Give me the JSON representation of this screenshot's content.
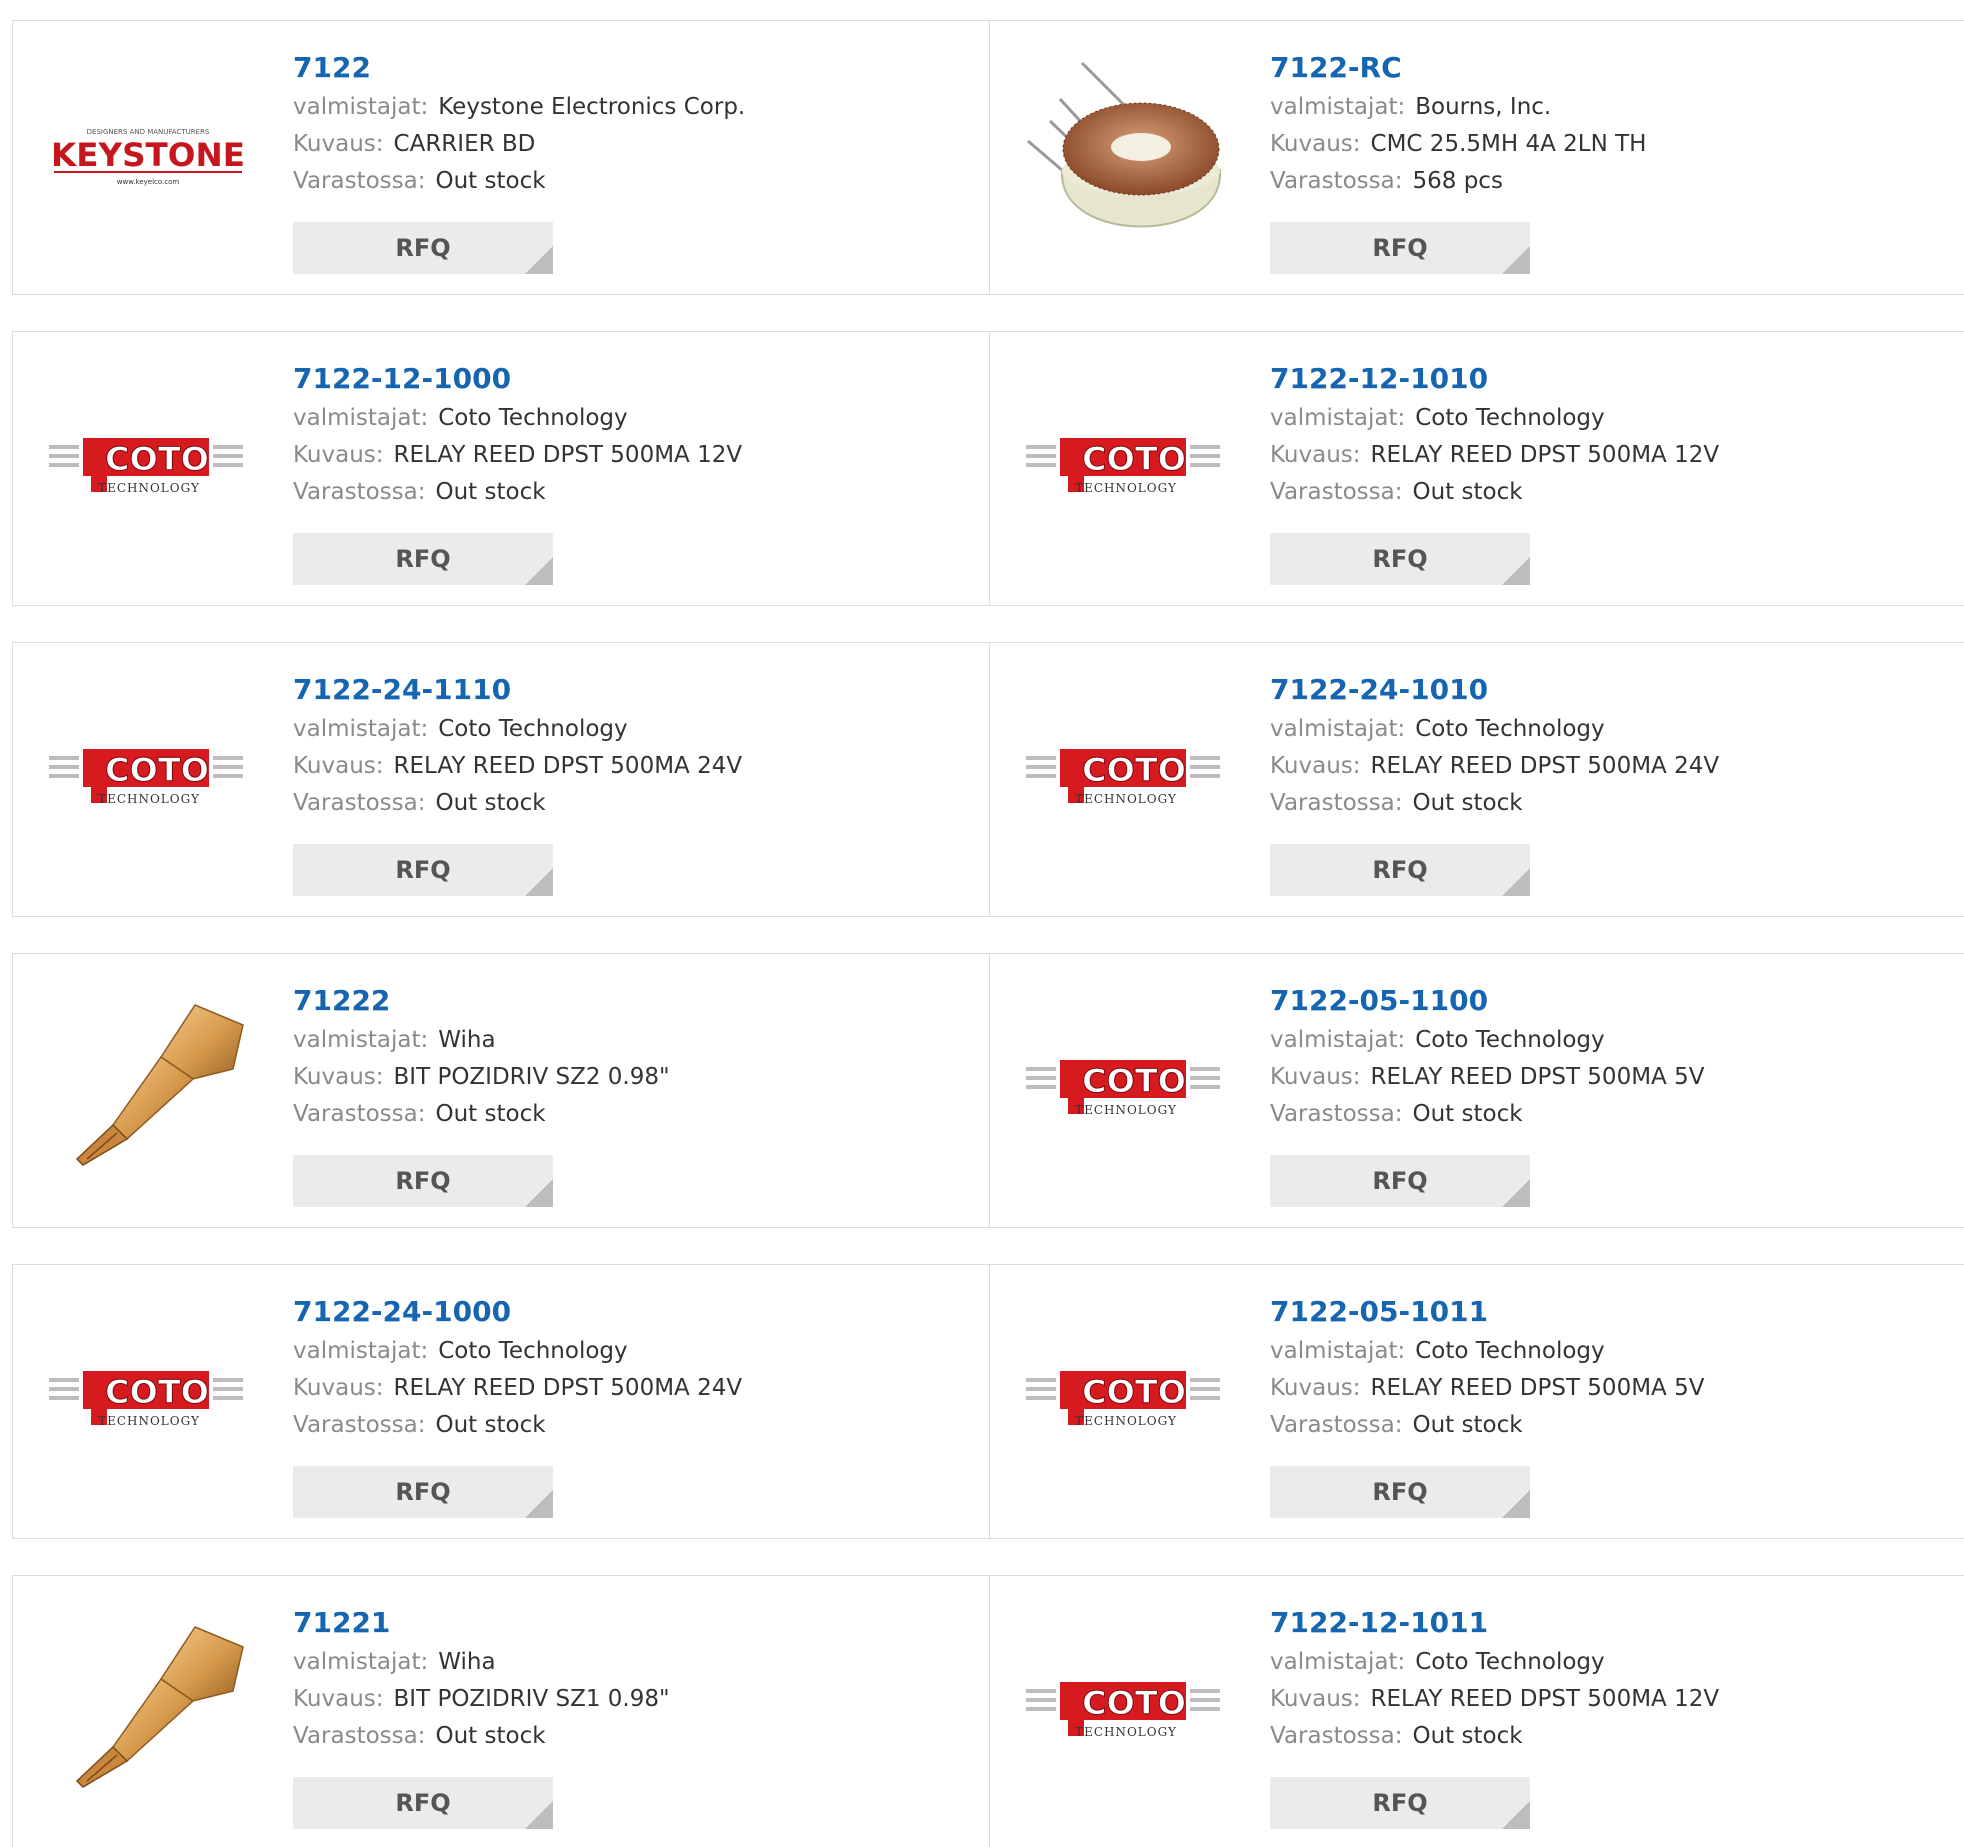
{
  "labels": {
    "maker": "valmistajat:",
    "desc": "Kuvaus:",
    "stock": "Varastossa:",
    "rfq": "RFQ"
  },
  "logos": {
    "keystone_tag": "DESIGNERS AND MANUFACTURERS",
    "keystone": "KEYSTONE",
    "keystone_url": "www.keyelco.com",
    "coto": "COTO",
    "coto_sub": "TECHNOLOGY"
  },
  "products": [
    {
      "part": "7122",
      "maker": "Keystone Electronics Corp.",
      "desc": "CARRIER BD",
      "stock": "Out stock",
      "image": "keystone-logo"
    },
    {
      "part": "7122-RC",
      "maker": "Bourns, Inc.",
      "desc": "CMC 25.5MH 4A 2LN TH",
      "stock": "568 pcs",
      "image": "toroid-inductor"
    },
    {
      "part": "7122-12-1000",
      "maker": "Coto Technology",
      "desc": "RELAY REED DPST 500MA 12V",
      "stock": "Out stock",
      "image": "coto-logo"
    },
    {
      "part": "7122-12-1010",
      "maker": "Coto Technology",
      "desc": "RELAY REED DPST 500MA 12V",
      "stock": "Out stock",
      "image": "coto-logo"
    },
    {
      "part": "7122-24-1110",
      "maker": "Coto Technology",
      "desc": "RELAY REED DPST 500MA 24V",
      "stock": "Out stock",
      "image": "coto-logo"
    },
    {
      "part": "7122-24-1010",
      "maker": "Coto Technology",
      "desc": "RELAY REED DPST 500MA 24V",
      "stock": "Out stock",
      "image": "coto-logo"
    },
    {
      "part": "71222",
      "maker": "Wiha",
      "desc": "BIT POZIDRIV SZ2 0.98\"",
      "stock": "Out stock",
      "image": "screwdriver-bit"
    },
    {
      "part": "7122-05-1100",
      "maker": "Coto Technology",
      "desc": "RELAY REED DPST 500MA 5V",
      "stock": "Out stock",
      "image": "coto-logo"
    },
    {
      "part": "7122-24-1000",
      "maker": "Coto Technology",
      "desc": "RELAY REED DPST 500MA 24V",
      "stock": "Out stock",
      "image": "coto-logo"
    },
    {
      "part": "7122-05-1011",
      "maker": "Coto Technology",
      "desc": "RELAY REED DPST 500MA 5V",
      "stock": "Out stock",
      "image": "coto-logo"
    },
    {
      "part": "71221",
      "maker": "Wiha",
      "desc": "BIT POZIDRIV SZ1 0.98\"",
      "stock": "Out stock",
      "image": "screwdriver-bit"
    },
    {
      "part": "7122-12-1011",
      "maker": "Coto Technology",
      "desc": "RELAY REED DPST 500MA 12V",
      "stock": "Out stock",
      "image": "coto-logo"
    }
  ]
}
